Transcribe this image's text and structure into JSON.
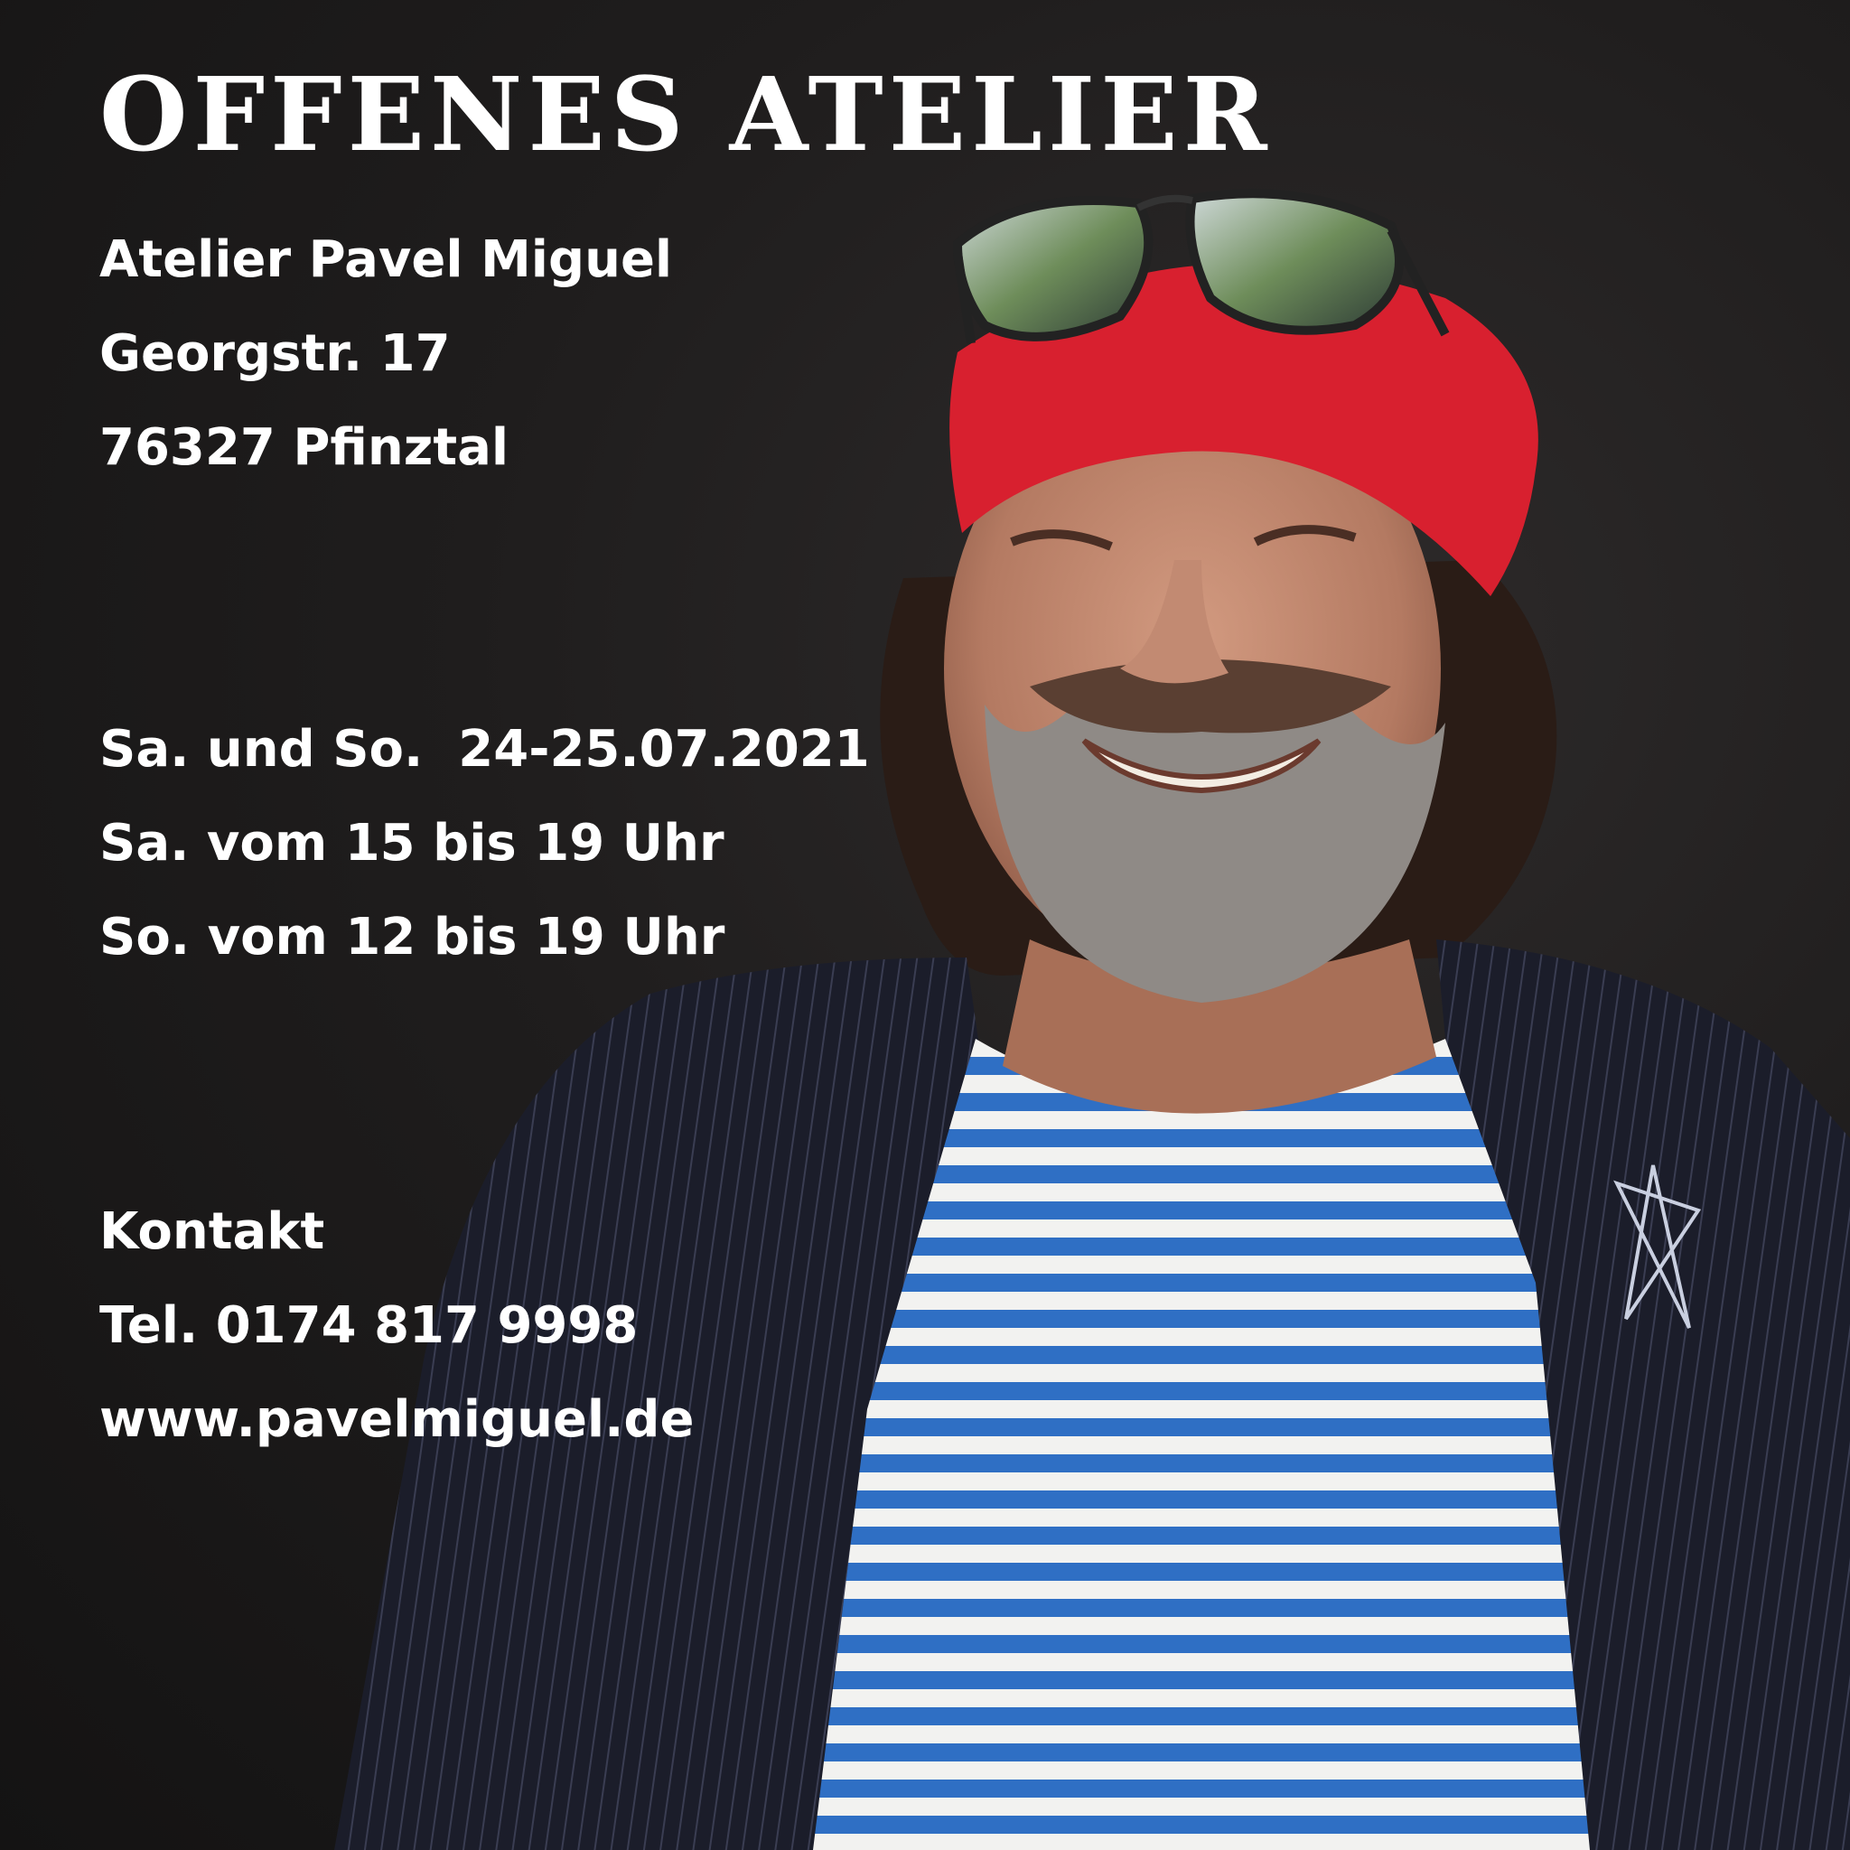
{
  "headline": "OFFENES ATELIER",
  "address": {
    "name": "Atelier Pavel Miguel",
    "street": "Georgstr. 17",
    "city": "76327 Pfinztal"
  },
  "schedule": {
    "dates": "Sa. und So.  24-25.07.2021",
    "saturday": "Sa. vom 15 bis 19 Uhr",
    "sunday": "So. vom 12 bis 19 Uhr"
  },
  "contact": {
    "heading": "Kontakt",
    "phone": "Tel. 0174 817 9998",
    "website": "www.pavelmiguel.de"
  },
  "colors": {
    "background": "#1c1a1a",
    "text": "#ffffff",
    "bandana": "#d8202f",
    "shirt_stripe": "#2f6fc4",
    "jacket": "#1b1d2a"
  }
}
